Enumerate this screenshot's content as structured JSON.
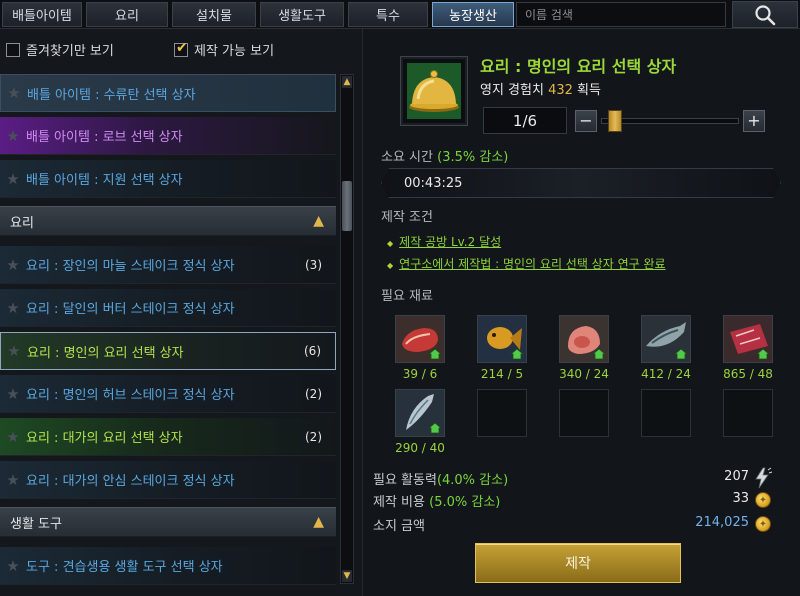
{
  "tabs": [
    {
      "label": "배틀아이템",
      "active": false
    },
    {
      "label": "요리",
      "active": false
    },
    {
      "label": "설치물",
      "active": false
    },
    {
      "label": "생활도구",
      "active": false
    },
    {
      "label": "특수",
      "active": false
    },
    {
      "label": "농장생산",
      "active": true
    }
  ],
  "search": {
    "placeholder": "이름 검색",
    "icon": "search-icon"
  },
  "filters": {
    "favorites_label": "즐겨찾기만 보기",
    "favorites_checked": false,
    "craftable_label": "제작 가능 보기",
    "craftable_checked": true
  },
  "list": {
    "battle_items": [
      {
        "label": "배틀 아이템 : 수류탄 선택 상자",
        "style": "hover"
      },
      {
        "label": "배틀 아이템 : 로브 선택 상자",
        "style": "purple"
      },
      {
        "label": "배틀 아이템 : 지원 선택 상자",
        "style": "blue"
      }
    ],
    "cooking_category": "요리",
    "cooking_items": [
      {
        "label": "요리 : 장인의 마늘 스테이크 정식 상자",
        "count": "(3)",
        "style": "blue"
      },
      {
        "label": "요리 : 달인의 버터 스테이크 정식 상자",
        "count": "",
        "style": "blue"
      },
      {
        "label": "요리 : 명인의 요리 선택 상자",
        "count": "(6)",
        "style": "green-selected"
      },
      {
        "label": "요리 : 명인의 허브 스테이크 정식 상자",
        "count": "(2)",
        "style": "blue"
      },
      {
        "label": "요리 : 대가의 요리 선택 상자",
        "count": "(2)",
        "style": "green"
      },
      {
        "label": "요리 : 대가의 안심 스테이크 정식 상자",
        "count": "",
        "style": "blue"
      }
    ],
    "tools_category": "생활 도구",
    "tools_items": [
      {
        "label": "도구 : 견습생용 생활 도구 선택 상자",
        "style": "blue"
      }
    ]
  },
  "detail": {
    "title": "요리 : 명인의 요리 선택 상자",
    "exp_label": "영지 경험치",
    "exp_value": "432",
    "exp_suffix": "획득",
    "quantity": "1/6",
    "slider_level": 0.05,
    "time_label": "소요 시간",
    "time_discount": "(3.5% 감소)",
    "time_value": "00:43:25",
    "conditions_label": "제작 조건",
    "conditions": [
      "제작 공방 Lv.2 달성",
      "연구소에서 제작법 : 명인의 요리 선택 상자 연구 완료"
    ],
    "materials_label": "필요 재료",
    "materials": [
      {
        "icon": "raw-meat-icon",
        "qty": "39 / 6"
      },
      {
        "icon": "golden-fish-icon",
        "qty": "214 / 5"
      },
      {
        "icon": "ham-icon",
        "qty": "340 / 24"
      },
      {
        "icon": "mackerel-icon",
        "qty": "412 / 24"
      },
      {
        "icon": "marbled-meat-icon",
        "qty": "865 / 48"
      },
      {
        "icon": "silver-fish-icon",
        "qty": "290 / 40"
      }
    ],
    "energy_label": "필요 활동력",
    "energy_discount": "(4.0% 감소)",
    "energy_value": "207",
    "cost_label": "제작 비용",
    "cost_discount": "(5.0% 감소)",
    "cost_value": "33",
    "gold_label": "소지 금액",
    "gold_value": "214,025",
    "craft_button": "제작"
  },
  "colors": {
    "accent_gold": "#e2b64b",
    "title_green": "#9cd83a",
    "link_blue": "#5aa7e0",
    "purple_text": "#d08cf5"
  }
}
